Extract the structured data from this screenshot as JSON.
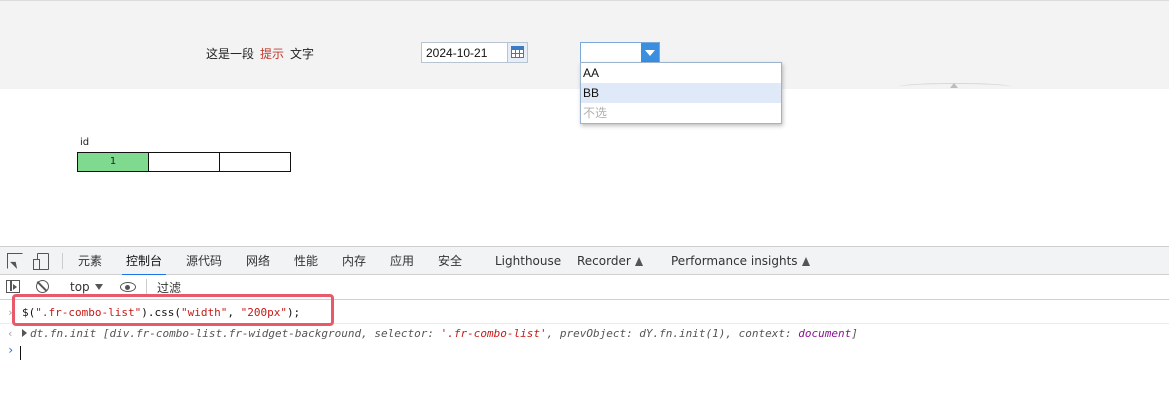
{
  "report": {
    "hint_prefix": "这是一段",
    "hint_highlight": "提示",
    "hint_suffix": "文字",
    "date_value": "2024-10-21",
    "combo_value": "",
    "combo_options": [
      "AA",
      "BB",
      "不选"
    ],
    "combo_selected_index": 1,
    "column_header": "id",
    "row_cells": [
      "1",
      "",
      ""
    ],
    "colors": {
      "highlight_text": "#c0392b",
      "cell_green": "#7fd98f",
      "combo_button": "#3b8fe0"
    }
  },
  "devtools": {
    "tabs": [
      "元素",
      "控制台",
      "源代码",
      "网络",
      "性能",
      "内存",
      "应用",
      "安全",
      "Lighthouse",
      "Recorder",
      "Performance insights"
    ],
    "active_tab": "控制台",
    "context": "top",
    "filter_placeholder": "过滤",
    "command_prefix": "$(",
    "command_selector": "\".fr-combo-list\"",
    "command_mid": ").css(",
    "command_arg1": "\"width\"",
    "command_comma": ", ",
    "command_arg2": "\"200px\"",
    "command_end": ");",
    "result_head": "dt.fn.init [",
    "result_body": "div.fr-combo-list.fr-widget-background, ",
    "result_selector_key": "selector: ",
    "result_selector_val": "'.fr-combo-list'",
    "result_prev": ", prevObject: dY.fn.init(1), ",
    "result_context_key": "context: ",
    "result_context_val": "document",
    "result_end": "]",
    "accent": "#1a73e8",
    "annotation_color": "#e85a6a"
  }
}
